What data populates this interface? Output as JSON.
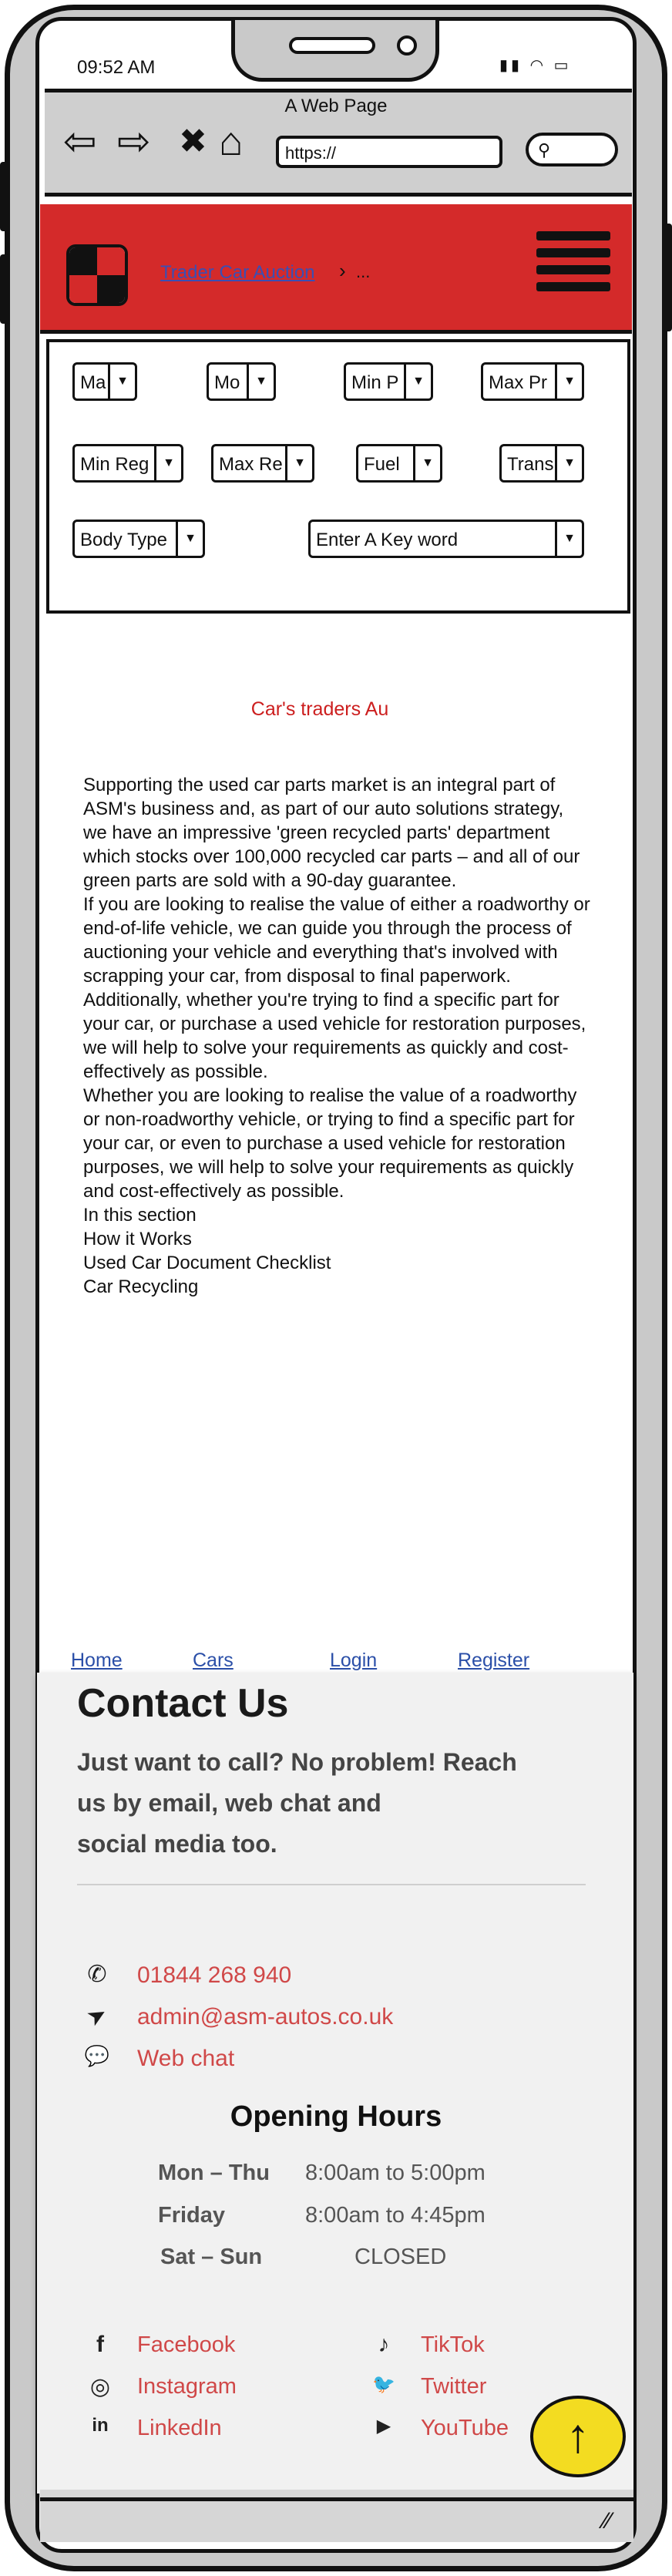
{
  "status": {
    "time": "09:52 AM",
    "icons": "▮▮ ◠ ▭"
  },
  "browser": {
    "title": "A Web Page",
    "url": "https://",
    "back_icon": "⇦",
    "forward_icon": "⇨",
    "close_icon": "✖",
    "home_icon": "⌂",
    "search_icon": "⚲"
  },
  "header": {
    "breadcrumb_link": "Trader Car Auction",
    "breadcrumb_sep": "›",
    "breadcrumb_more": "..."
  },
  "filters": {
    "make": "Ma",
    "model": "Mo",
    "min_price": "Min P",
    "max_price": "Max Pr",
    "min_reg": "Min Reg",
    "max_reg": "Max Re",
    "fuel": "Fuel",
    "transmission": "Trans",
    "body_type": "Body Type",
    "keyword": "Enter A Key word",
    "arrow": "▼"
  },
  "site_title": "Car's traders Au",
  "content": {
    "paragraphs": [
      "Supporting the used car parts market is an integral part of ASM's business and, as part of our auto solutions strategy, we have an impressive 'green recycled parts' department which stocks over 100,000 recycled car parts – and all of our green parts are sold with a 90-day guarantee.",
      "If you are looking to realise the value of either a roadworthy or end-of-life vehicle, we can guide you through the process of auctioning your vehicle and everything that's involved with scrapping your car, from disposal to final paperwork.  Additionally, whether you're trying to find a specific part for your car, or purchase a used vehicle for restoration purposes, we will help to solve your requirements as quickly and cost-effectively as possible.",
      "Whether you are looking to realise the value of a roadworthy or non-roadworthy vehicle, or trying to find a specific part for your car, or even to purchase a used vehicle for restoration purposes, we will help to solve your requirements as quickly and cost-effectively as possible."
    ],
    "section_heading": "In this section",
    "section_links": [
      "How it Works",
      "Used Car Document Checklist",
      "Car Recycling"
    ]
  },
  "nav": {
    "home": "Home",
    "cars": "Cars",
    "login": "Login",
    "register": "Register"
  },
  "contact": {
    "title": "Contact Us",
    "subtitle_lines": [
      "Just want to call? No problem! Reach",
      "us by email, web chat and",
      "social media too."
    ],
    "phone": "01844 268 940",
    "email": "admin@asm-autos.co.uk",
    "webchat": "Web chat",
    "phone_icon": "✆",
    "email_icon": "➤",
    "chat_icon": "💬"
  },
  "hours": {
    "title": "Opening Hours",
    "rows": [
      {
        "day": "Mon – Thu",
        "time": "8:00am to 5:00pm"
      },
      {
        "day": "Friday",
        "time": "8:00am to 4:45pm"
      },
      {
        "day": "Sat – Sun",
        "time": "CLOSED"
      }
    ]
  },
  "social": {
    "facebook": "Facebook",
    "instagram": "Instagram",
    "linkedin": "LinkedIn",
    "tiktok": "TikTok",
    "twitter": "Twitter",
    "youtube": "YouTube",
    "facebook_icon": "f",
    "instagram_icon": "◎",
    "linkedin_icon": "in",
    "tiktok_icon": "♪",
    "twitter_icon": "🐦",
    "youtube_icon": "▶"
  },
  "fab_icon": "↑",
  "resize_icon": "⁄⁄",
  "colors": {
    "header_red": "#d42a2a",
    "link_red": "#d04848",
    "fab_yellow": "#f3dc21",
    "link_blue": "#2b4fa8"
  }
}
